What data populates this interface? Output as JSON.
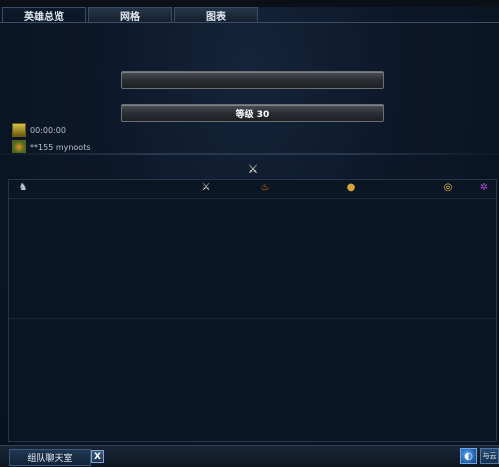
{
  "tabs": [
    {
      "label": "英雄总览",
      "active": true
    },
    {
      "label": "网格",
      "active": false
    },
    {
      "label": "图表",
      "active": false
    }
  ],
  "bars": {
    "top_label": "",
    "level_label": "等级 30"
  },
  "info": {
    "time": "00:00:00",
    "player": "**155 mynoots"
  },
  "table": {
    "header_icons": [
      "hero-icon",
      "crossed-swords-icon",
      "fire-icon",
      "gold-bag-icon",
      "coins-icon",
      "spider-icon"
    ]
  },
  "bottom": {
    "chat_label": "组队聊天室",
    "close_label": "X",
    "right_label": "与云"
  },
  "colors": {
    "background": "#0d1726",
    "bar_fill": "#2b2e33",
    "accent_blue": "#3a5877"
  }
}
